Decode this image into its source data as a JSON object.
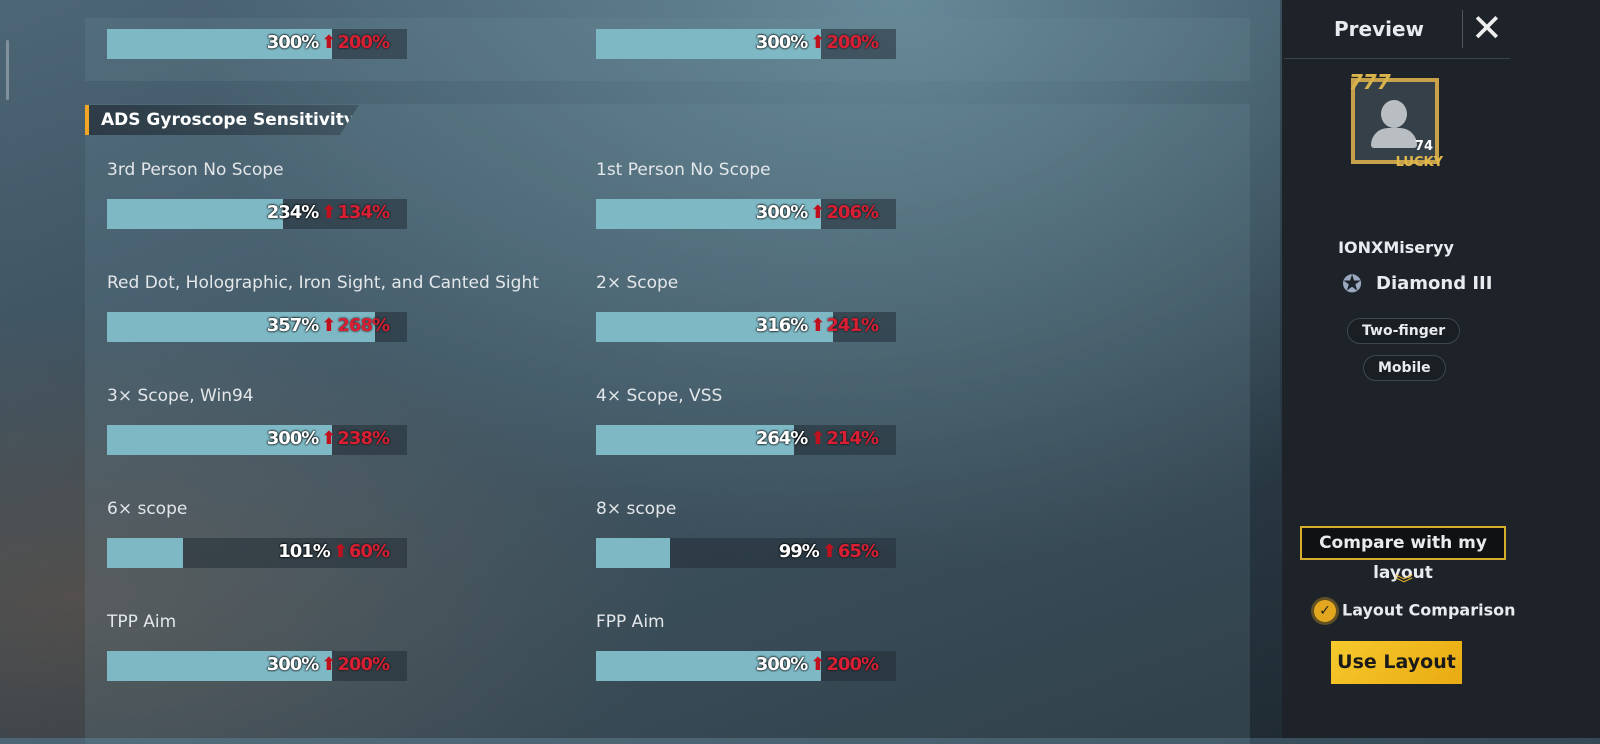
{
  "scale_max_percent": 400,
  "top_rows": [
    {
      "current": "300%",
      "previous": "200%",
      "value": 300
    },
    {
      "current": "300%",
      "previous": "200%",
      "value": 300
    }
  ],
  "section": {
    "title": "ADS Gyroscope Sensitivity",
    "accent": "#f2a623"
  },
  "rows": [
    {
      "label": "3rd Person No Scope",
      "current": "234%",
      "previous": "134%",
      "value": 234
    },
    {
      "label": "1st Person No Scope",
      "current": "300%",
      "previous": "206%",
      "value": 300
    },
    {
      "label": "Red Dot, Holographic, Iron Sight, and Canted Sight",
      "current": "357%",
      "previous": "268%",
      "value": 357
    },
    {
      "label": "2× Scope",
      "current": "316%",
      "previous": "241%",
      "value": 316
    },
    {
      "label": "3× Scope, Win94",
      "current": "300%",
      "previous": "238%",
      "value": 300
    },
    {
      "label": "4× Scope, VSS",
      "current": "264%",
      "previous": "214%",
      "value": 264
    },
    {
      "label": "6× scope",
      "current": "101%",
      "previous": "60%",
      "value": 101
    },
    {
      "label": "8× scope",
      "current": "99%",
      "previous": "65%",
      "value": 99
    },
    {
      "label": "TPP Aim",
      "current": "300%",
      "previous": "200%",
      "value": 300
    },
    {
      "label": "FPP Aim",
      "current": "300%",
      "previous": "200%",
      "value": 300
    }
  ],
  "up_arrow": "⬆",
  "sidebar": {
    "title": "Preview",
    "close": "✕",
    "avatar": {
      "level": "74",
      "frame_text": "LUCKY",
      "frame_number": "777"
    },
    "player_name": "IONXMiseryy",
    "rank": "Diamond III",
    "tags": [
      "Two-finger",
      "Mobile"
    ],
    "compare_button": "Compare with my layout",
    "chevron": "︾",
    "comparison_label": "Layout Comparison",
    "check": "✓",
    "use_button": "Use Layout"
  }
}
